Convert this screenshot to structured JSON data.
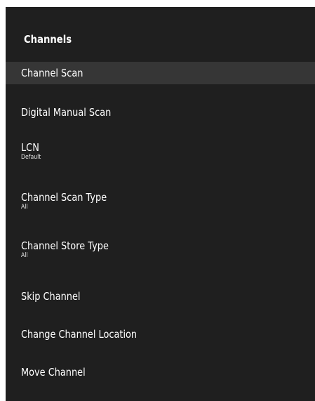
{
  "panel": {
    "title": "Channels",
    "background_color": "#1f1f1f",
    "focus_color": "#363636",
    "items": [
      {
        "label": "Channel Scan",
        "focused": true
      },
      {
        "label": "Digital Manual Scan"
      },
      {
        "label": "LCN",
        "value": "Default"
      },
      {
        "label": "Channel Scan Type",
        "value": "All"
      },
      {
        "label": "Channel Store Type",
        "value": "All"
      },
      {
        "label": "Skip Channel"
      },
      {
        "label": "Change Channel Location"
      },
      {
        "label": "Move Channel"
      }
    ]
  }
}
